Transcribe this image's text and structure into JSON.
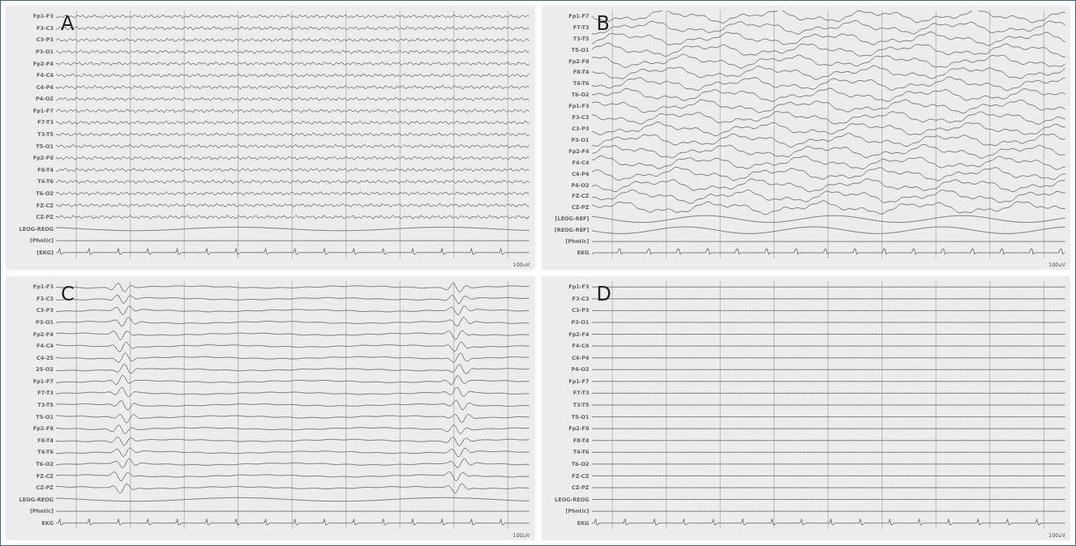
{
  "panels": [
    {
      "letter": "A",
      "kind": "fast",
      "scale": "100uV",
      "channels": [
        {
          "label": "Fp1-F3",
          "kind": "eeg"
        },
        {
          "label": "F3-C3",
          "kind": "eeg"
        },
        {
          "label": "C3-P3",
          "kind": "eeg"
        },
        {
          "label": "P3-O1",
          "kind": "eeg"
        },
        {
          "label": "Fp2-F4",
          "kind": "eeg"
        },
        {
          "label": "F4-C4",
          "kind": "eeg"
        },
        {
          "label": "C4-P4",
          "kind": "eeg"
        },
        {
          "label": "P4-O2",
          "kind": "eeg"
        },
        {
          "label": "Fp1-F7",
          "kind": "eeg"
        },
        {
          "label": "F7-T3",
          "kind": "eeg"
        },
        {
          "label": "T3-T5",
          "kind": "eeg"
        },
        {
          "label": "T5-O1",
          "kind": "eeg"
        },
        {
          "label": "Fp2-F8",
          "kind": "eeg"
        },
        {
          "label": "F8-T4",
          "kind": "eeg"
        },
        {
          "label": "T4-T6",
          "kind": "eeg"
        },
        {
          "label": "T6-O2",
          "kind": "eeg"
        },
        {
          "label": "FZ-CZ",
          "kind": "eeg"
        },
        {
          "label": "CZ-PZ",
          "kind": "eeg"
        },
        {
          "label": "LEOG-REOG",
          "kind": "eog"
        },
        {
          "label": "[Photic]",
          "kind": "photic"
        },
        {
          "label": "[EKG]",
          "kind": "ekg"
        }
      ]
    },
    {
      "letter": "B",
      "kind": "slow",
      "scale": "100uV",
      "channels": [
        {
          "label": "Fp1-F7",
          "kind": "eeg"
        },
        {
          "label": "F7-T3",
          "kind": "eeg"
        },
        {
          "label": "T3-T5",
          "kind": "eeg"
        },
        {
          "label": "T5-O1",
          "kind": "eeg"
        },
        {
          "label": "Fp2-F8",
          "kind": "eeg"
        },
        {
          "label": "F8-T4",
          "kind": "eeg"
        },
        {
          "label": "T4-T6",
          "kind": "eeg"
        },
        {
          "label": "T6-O2",
          "kind": "eeg"
        },
        {
          "label": "Fp1-F3",
          "kind": "eeg"
        },
        {
          "label": "F3-C3",
          "kind": "eeg"
        },
        {
          "label": "C3-P3",
          "kind": "eeg"
        },
        {
          "label": "P3-O1",
          "kind": "eeg"
        },
        {
          "label": "Fp2-F4",
          "kind": "eeg"
        },
        {
          "label": "F4-C4",
          "kind": "eeg"
        },
        {
          "label": "C4-P4",
          "kind": "eeg"
        },
        {
          "label": "P4-O2",
          "kind": "eeg"
        },
        {
          "label": "FZ-CZ",
          "kind": "eeg"
        },
        {
          "label": "CZ-PZ",
          "kind": "eeg"
        },
        {
          "label": "[LEOG-REF]",
          "kind": "eog"
        },
        {
          "label": "[REOG-REF]",
          "kind": "eog"
        },
        {
          "label": "[Photic]",
          "kind": "photic"
        },
        {
          "label": "EKG",
          "kind": "ekg"
        }
      ]
    },
    {
      "letter": "C",
      "kind": "burst",
      "scale": "100uV",
      "channels": [
        {
          "label": "Fp1-F3",
          "kind": "eeg"
        },
        {
          "label": "F3-C3",
          "kind": "eeg"
        },
        {
          "label": "C3-P3",
          "kind": "eeg"
        },
        {
          "label": "P3-O1",
          "kind": "eeg"
        },
        {
          "label": "Fp2-F4",
          "kind": "eeg"
        },
        {
          "label": "F4-C4",
          "kind": "eeg"
        },
        {
          "label": "C4-25",
          "kind": "eeg"
        },
        {
          "label": "25-O2",
          "kind": "eeg"
        },
        {
          "label": "Fp1-F7",
          "kind": "eeg"
        },
        {
          "label": "F7-T3",
          "kind": "eeg"
        },
        {
          "label": "T3-T5",
          "kind": "eeg"
        },
        {
          "label": "T5-O1",
          "kind": "eeg"
        },
        {
          "label": "Fp2-F8",
          "kind": "eeg"
        },
        {
          "label": "F8-T4",
          "kind": "eeg"
        },
        {
          "label": "T4-T6",
          "kind": "eeg"
        },
        {
          "label": "T6-O2",
          "kind": "eeg"
        },
        {
          "label": "FZ-CZ",
          "kind": "eeg"
        },
        {
          "label": "CZ-PZ",
          "kind": "eeg"
        },
        {
          "label": "LEOG-REOG",
          "kind": "eog"
        },
        {
          "label": "[Photic]",
          "kind": "photic"
        },
        {
          "label": "EKG",
          "kind": "ekg"
        }
      ]
    },
    {
      "letter": "D",
      "kind": "flat",
      "scale": "100uV",
      "channels": [
        {
          "label": "Fp1-F3",
          "kind": "eeg"
        },
        {
          "label": "F3-C3",
          "kind": "eeg"
        },
        {
          "label": "C3-P3",
          "kind": "eeg"
        },
        {
          "label": "P3-O1",
          "kind": "eeg"
        },
        {
          "label": "Fp2-F4",
          "kind": "eeg"
        },
        {
          "label": "F4-C4",
          "kind": "eeg"
        },
        {
          "label": "C4-P4",
          "kind": "eeg"
        },
        {
          "label": "P4-O2",
          "kind": "eeg"
        },
        {
          "label": "Fp1-F7",
          "kind": "eeg"
        },
        {
          "label": "F7-T3",
          "kind": "eeg"
        },
        {
          "label": "T3-T5",
          "kind": "eeg"
        },
        {
          "label": "T5-O1",
          "kind": "eeg"
        },
        {
          "label": "Fp2-F8",
          "kind": "eeg"
        },
        {
          "label": "F8-T4",
          "kind": "eeg"
        },
        {
          "label": "T4-T6",
          "kind": "eeg"
        },
        {
          "label": "T6-O2",
          "kind": "eeg"
        },
        {
          "label": "FZ-CZ",
          "kind": "eeg"
        },
        {
          "label": "CZ-PZ",
          "kind": "eeg"
        },
        {
          "label": "LEOG-REOG",
          "kind": "eog"
        },
        {
          "label": "[Photic]",
          "kind": "photic"
        },
        {
          "label": "EKG",
          "kind": "ekg"
        }
      ]
    }
  ]
}
